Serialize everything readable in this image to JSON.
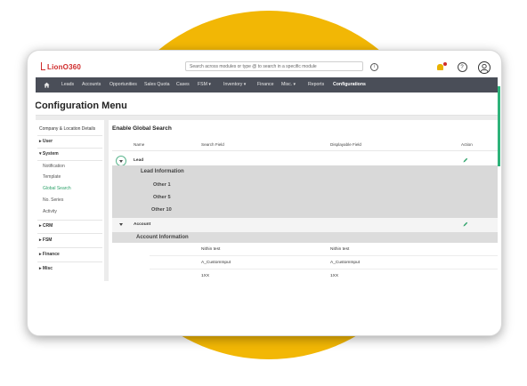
{
  "app": {
    "logo_text": "LionO360",
    "brand_color": "#cf2a2a",
    "accent_color": "#2fa36b",
    "background_circle_color": "#f2b705"
  },
  "header": {
    "search_placeholder": "Search across modules or type @ to search in a specific module",
    "info_icon": "info-icon",
    "notifications_icon": "bell-icon",
    "help_icon": "help-icon",
    "help_glyph": "?",
    "avatar_icon": "user-avatar-icon"
  },
  "nav": {
    "home_icon": "home-icon",
    "items": [
      {
        "label": "Leads"
      },
      {
        "label": "Accounts"
      },
      {
        "label": "Opportunities"
      },
      {
        "label": "Sales Quota"
      },
      {
        "label": "Cases"
      },
      {
        "label": "FSM ▾"
      },
      {
        "label": "Inventory ▾"
      },
      {
        "label": "Finance"
      },
      {
        "label": "Misc. ▾"
      },
      {
        "label": "Reports"
      },
      {
        "label": "Configurations"
      }
    ]
  },
  "page": {
    "title": "Configuration Menu"
  },
  "sidebar": {
    "top": "Company & Location Details",
    "user": "▸ User",
    "system": "▾ System",
    "system_children": [
      "Notification",
      "Template",
      "Global Search",
      "No. Series",
      "Activity"
    ],
    "crm": "▸ CRM",
    "fsm": "▸ FSM",
    "finance": "▸ Finance",
    "misc": "▸ Misc"
  },
  "main": {
    "title": "Enable Global Search",
    "columns": {
      "name": "Name",
      "search_field": "Search Field",
      "displayable_field": "Displayable Field",
      "action": "Action"
    },
    "lead": {
      "name": "Lead",
      "group_title": "Lead Information",
      "items": [
        "Other 1",
        "Other 5",
        "Other 10"
      ]
    },
    "account": {
      "name": "Account",
      "group_title": "Account Information",
      "rows": [
        {
          "search": "Nithin test",
          "display": "Nithin test"
        },
        {
          "search": "A_CustomInput",
          "display": "A_CustomInput"
        },
        {
          "search": "1XX",
          "display": "1XX"
        }
      ]
    },
    "edit_icon": "pencil-icon"
  }
}
